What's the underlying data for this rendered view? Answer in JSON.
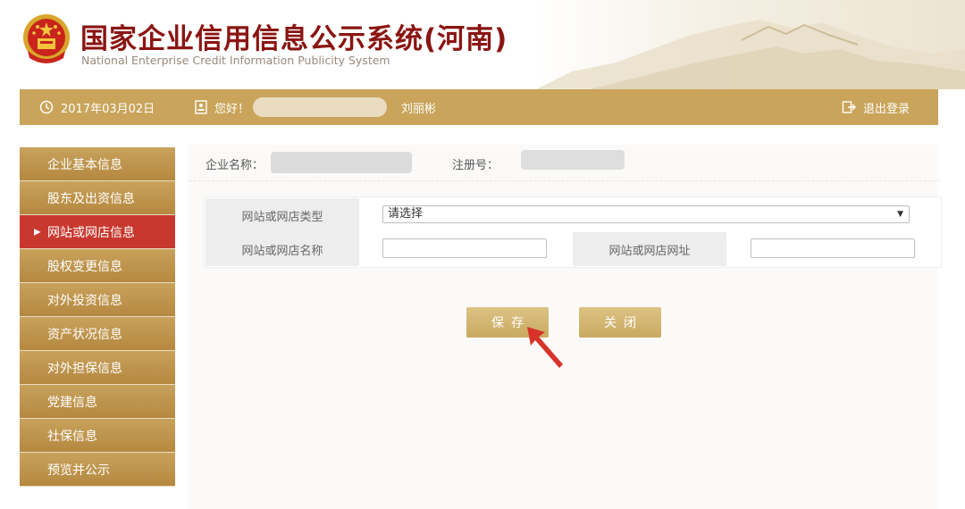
{
  "header": {
    "title": "国家企业信用信息公示系统(河南)",
    "subtitle": "National Enterprise Credit Information Publicity System"
  },
  "topbar": {
    "date": "2017年03月02日",
    "greeting": "您好！",
    "user_name": "刘丽彬",
    "logout_label": "退出登录",
    "icons": [
      "clock-icon",
      "id-card-icon",
      "logout-icon"
    ]
  },
  "sidebar": {
    "items": [
      {
        "label": "企业基本信息"
      },
      {
        "label": "股东及出资信息"
      },
      {
        "label": "网站或网店信息",
        "active": true
      },
      {
        "label": "股权变更信息"
      },
      {
        "label": "对外投资信息"
      },
      {
        "label": "资产状况信息"
      },
      {
        "label": "对外担保信息"
      },
      {
        "label": "党建信息"
      },
      {
        "label": "社保信息"
      },
      {
        "label": "预览并公示"
      }
    ]
  },
  "info": {
    "company_label": "企业名称：",
    "reg_label": "注册号："
  },
  "form": {
    "type_label": "网站或网店类型",
    "type_value": "请选择",
    "name_label": "网站或网店名称",
    "name_value": "",
    "url_label": "网站或网店网址",
    "url_value": ""
  },
  "buttons": {
    "save": "保存",
    "close": "关闭"
  },
  "colors": {
    "gold": "#c9a45a",
    "active_red": "#c8382e",
    "title_red": "#8a1512"
  }
}
